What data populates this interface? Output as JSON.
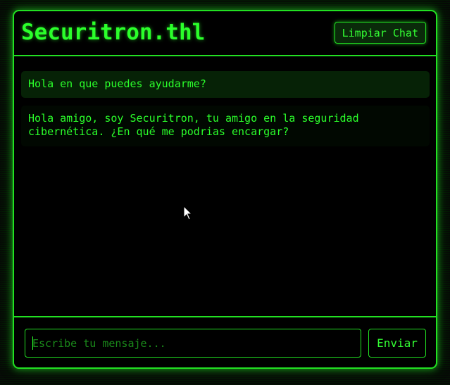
{
  "header": {
    "title": "Securitron.thl",
    "clear_label": "Limpiar Chat"
  },
  "messages": [
    {
      "role": "user",
      "text": "Hola en que puedes ayudarme?"
    },
    {
      "role": "bot",
      "text": "Hola amigo, soy Securitron, tu amigo en la seguridad\ncibernética. ¿En qué me podrias encargar?"
    }
  ],
  "input": {
    "value": "",
    "placeholder": "Escribe tu mensaje..."
  },
  "send_label": "Enviar",
  "colors": {
    "accent": "#22e022",
    "text": "#2bff2b",
    "background": "#000000",
    "user_bubble": "#062206"
  },
  "pointer_icon": "mouse-pointer-icon"
}
